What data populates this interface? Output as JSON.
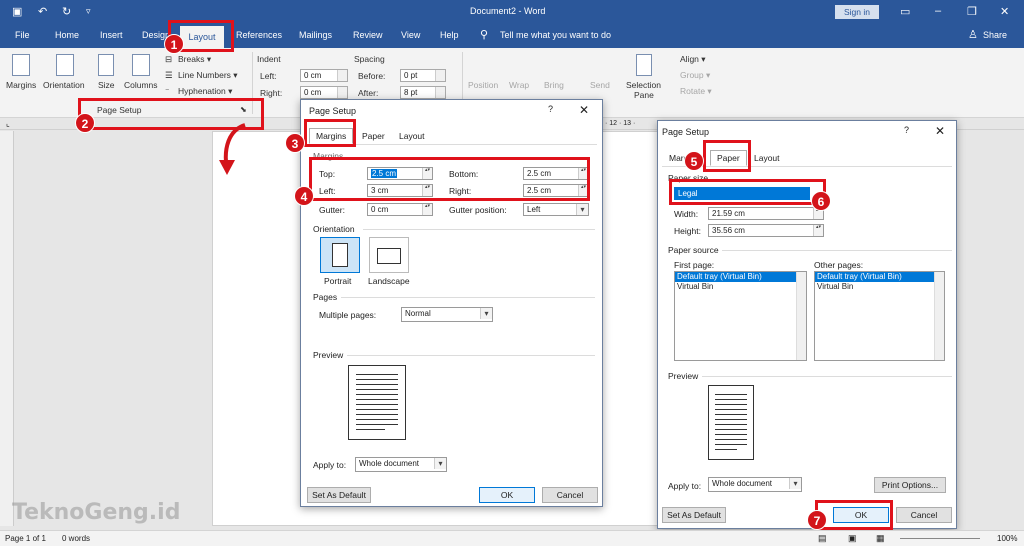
{
  "titlebar": {
    "doc_title": "Document2 - Word",
    "sign_in": "Sign in",
    "qat_icons": [
      "save-icon",
      "undo-icon",
      "redo-icon",
      "customize-icon"
    ],
    "window_icons": [
      "ribbon-display-icon",
      "minimize-icon",
      "restore-icon",
      "close-icon"
    ]
  },
  "tabs": [
    "File",
    "Home",
    "Insert",
    "Design",
    "Layout",
    "References",
    "Mailings",
    "Review",
    "View",
    "Help"
  ],
  "tell_me": "Tell me what you want to do",
  "share": "Share",
  "ribbon": {
    "margins": "Margins",
    "orientation": "Orientation",
    "size": "Size",
    "columns": "Columns",
    "breaks": "Breaks ▾",
    "line_numbers": "Line Numbers ▾",
    "hyphenation": "Hyphenation ▾",
    "page_setup_group": "Page Setup",
    "indent": "Indent",
    "indent_left_label": "Left:",
    "indent_left_value": "0 cm",
    "indent_right_label": "Right:",
    "indent_right_value": "0 cm",
    "spacing": "Spacing",
    "before_label": "Before:",
    "before_value": "0 pt",
    "after_label": "After:",
    "after_value": "8 pt",
    "position": "Position",
    "wrap_text": "Wrap Text",
    "bring_forward": "Bring Forward",
    "send_backward": "Send Backward",
    "selection_pane_1": "Selection",
    "selection_pane_2": "Pane",
    "align": "Align ▾",
    "group": "Group ▾",
    "rotate": "Rotate ▾"
  },
  "ruler_text": "· 12 · 13 ·",
  "dialog1": {
    "title": "Page Setup",
    "help": "?",
    "tabs": [
      "Margins",
      "Paper",
      "Layout"
    ],
    "margins_section": "Margins",
    "top_label": "Top:",
    "top_value": "2.5 cm",
    "bottom_label": "Bottom:",
    "bottom_value": "2.5 cm",
    "left_label": "Left:",
    "left_value": "3 cm",
    "right_label": "Right:",
    "right_value": "2.5 cm",
    "gutter_label": "Gutter:",
    "gutter_value": "0 cm",
    "gutter_pos_label": "Gutter position:",
    "gutter_pos_value": "Left",
    "orientation_section": "Orientation",
    "portrait": "Portrait",
    "landscape": "Landscape",
    "pages_section": "Pages",
    "multiple_pages_label": "Multiple pages:",
    "multiple_pages_value": "Normal",
    "preview_section": "Preview",
    "apply_to_label": "Apply to:",
    "apply_to_value": "Whole document",
    "set_default": "Set As Default",
    "ok": "OK",
    "cancel": "Cancel"
  },
  "dialog2": {
    "title": "Page Setup",
    "help": "?",
    "tabs": [
      "Margins",
      "Paper",
      "Layout"
    ],
    "paper_size_section": "Paper size",
    "paper_size_value": "Legal",
    "width_label": "Width:",
    "width_value": "21.59 cm",
    "height_label": "Height:",
    "height_value": "35.56 cm",
    "paper_source_section": "Paper source",
    "first_page_label": "First page:",
    "other_pages_label": "Other pages:",
    "first_page_items": [
      "Default tray (Virtual Bin)",
      "Virtual Bin"
    ],
    "other_pages_items": [
      "Default tray (Virtual Bin)",
      "Virtual Bin"
    ],
    "preview_section": "Preview",
    "apply_to_label": "Apply to:",
    "apply_to_value": "Whole document",
    "print_options": "Print Options...",
    "set_default": "Set As Default",
    "ok": "OK",
    "cancel": "Cancel"
  },
  "steps": [
    "1",
    "2",
    "3",
    "4",
    "5",
    "6",
    "7"
  ],
  "statusbar": {
    "page": "Page 1 of 1",
    "words": "0 words",
    "zoom": "100%"
  },
  "watermark": "TeknoGeng.id",
  "colors": {
    "word_blue": "#2b579a",
    "highlight_red": "#e0121b",
    "selection_blue": "#0078d7"
  }
}
